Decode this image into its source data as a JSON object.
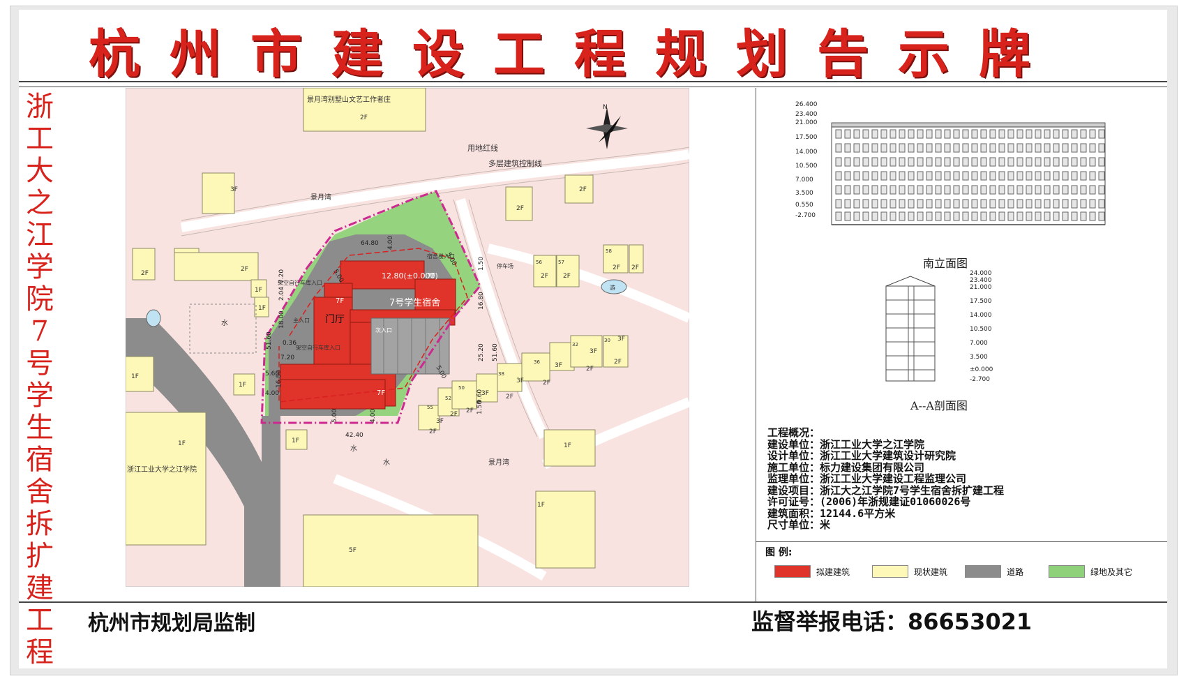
{
  "header": {
    "title": "杭州市建设工程规划告示牌"
  },
  "side_title": "浙工大之江学院7号学生宿舍拆扩建工程",
  "map": {
    "labels": {
      "villa": "景月湾别墅山文艺工作者庄",
      "red_line": "用地红线",
      "control_line": "多层建筑控制线",
      "jingyuewan_top": "景月湾",
      "jingyuewan_bottom": "景月湾",
      "parking": "停车场",
      "dorm": "7号学生宿舍",
      "lobby": "门厅",
      "main_entry": "主入口",
      "sub_entry": "次入口",
      "dorm_entry": "宿舍楼入口",
      "bike_entry_1": "架空自行车库入口",
      "bike_entry_2": "架空自行车库入口",
      "elevation_mark": "12.80(±0.000)",
      "water_1": "水",
      "water_2": "水",
      "water_3": "水",
      "pool": "游",
      "campus": "浙江工业大学之江学院"
    },
    "floors": {
      "f2_top": "2F",
      "f3": "3F",
      "f2a": "2F",
      "f2b": "2F",
      "f2c": "2F",
      "f2d": "2F",
      "f1a": "1F",
      "f1b": "1F",
      "f1c": "1F",
      "f1d": "1F",
      "f1e": "1F",
      "f1f": "1F",
      "f1g": "1F",
      "f1h": "1F",
      "f5": "5F",
      "f7a": "7F",
      "f7b": "7F",
      "f7c": "7F",
      "v56": "56",
      "v57": "57",
      "v58": "58",
      "v56f": "2F",
      "v57f": "2F",
      "v58f": "2F",
      "v58f2": "2F",
      "v32": "32",
      "v30": "30",
      "v36": "36",
      "v38": "38",
      "v50": "50",
      "v52": "52",
      "v55": "55",
      "r3fa": "3F",
      "r3fb": "3F",
      "r3fc": "3F",
      "r3fd": "3F",
      "r3fe": "3F",
      "r3ff": "3F",
      "r2fa": "2F",
      "r2fb": "2F",
      "r2fc": "2F",
      "r2fd": "2F",
      "r2fe": "2F",
      "r2ff": "2F",
      "r2fg": "2F"
    },
    "dims": {
      "d6480": "64.80",
      "d400a": "4.00",
      "d500a": "5.00",
      "d720": "7.20",
      "d204": "2.04",
      "d1800": "18.00",
      "d5160a": "51.60",
      "d036": "0.36",
      "d720b": "7.20",
      "d560": "5.60",
      "d1680": "16.80",
      "d400b": "4.00",
      "d500b": "5.00",
      "d400c": "4.00",
      "d4240": "42.40",
      "d150": "1.50",
      "d1680b": "16.80",
      "d2520": "25.20",
      "d5160b": "51.60",
      "d500c": "5.00",
      "d150b": "1.50",
      "d960": "9.60",
      "d500d": "5.00"
    },
    "north": "N"
  },
  "elevation": {
    "caption": "南立面图",
    "levels": [
      "26.400",
      "23.400",
      "21.000",
      "17.500",
      "14.000",
      "10.500",
      "7.000",
      "3.500",
      "0.550",
      "-2.700"
    ]
  },
  "section": {
    "caption": "A--A剖面图",
    "levels": [
      "24.000",
      "23.400",
      "21.000",
      "17.500",
      "14.000",
      "10.500",
      "7.000",
      "3.500",
      "±0.000",
      "-2.700"
    ]
  },
  "overview": {
    "rows": [
      "工程概况：",
      "建设单位：浙江工业大学之江学院",
      "设计单位：浙江工业大学建筑设计研究院",
      "施工单位：标力建设集团有限公司",
      "监理单位：浙江工业大学建设工程监理公司",
      "建设项目：浙江大之江学院7号学生宿舍拆扩建工程",
      "许可证号：(2006)年浙规建证01060026号",
      "建筑面积：12144.6平方米",
      "尺寸单位：米"
    ]
  },
  "legend": {
    "title": "图 例:",
    "items": [
      {
        "label": "拟建建筑",
        "color": "#e0342a"
      },
      {
        "label": "现状建筑",
        "color": "#fdf7b8"
      },
      {
        "label": "道路",
        "color": "#8c8c8c"
      },
      {
        "label": "绿地及其它",
        "color": "#8fd07a"
      }
    ]
  },
  "footer": {
    "left": "杭州市规划局监制",
    "right": "监督举报电话：86653021"
  }
}
